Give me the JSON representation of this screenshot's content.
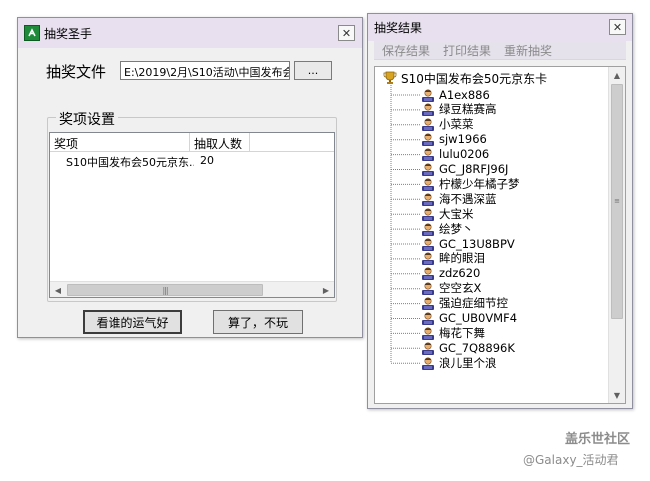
{
  "main_window": {
    "title": "抽奖圣手",
    "close_glyph": "✕",
    "file_label": "抽奖文件",
    "file_path": "E:\\2019\\2月\\S10活动\\中国发布会",
    "browse_label": "...",
    "group_label": "奖项设置",
    "columns": [
      "奖项",
      "抽取人数"
    ],
    "rows": [
      {
        "prize": "S10中国发布会50元京东...",
        "count": "20"
      }
    ],
    "scroll_left": "◀",
    "scroll_right": "▶",
    "scroll_grip": "|||",
    "lucky_button": "看谁的运气好",
    "quit_button": "算了，不玩"
  },
  "results_window": {
    "title": "抽奖结果",
    "close_glyph": "✕",
    "menu": [
      "保存结果",
      "打印结果",
      "重新抽奖"
    ],
    "root": "S10中国发布会50元京东卡",
    "winners": [
      "A1ex886",
      "绿豆糕赛高",
      "小菜菜",
      "sjw1966",
      "lulu0206",
      "GC_J8RFJ96J",
      "柠檬少年橘子梦",
      "海不遇深蓝",
      "大宝米",
      "绘梦丶",
      "GC_13U8BPV",
      "眸的眼泪",
      "zdz620",
      "空空玄X",
      "强迫症细节控",
      "GC_UB0VMF4",
      "梅花下舞",
      "GC_7Q8896K",
      "浪儿里个浪"
    ],
    "scroll_up": "▲",
    "scroll_down": "▼",
    "scroll_grip": "≡"
  },
  "watermark": {
    "line1": "盖乐世社区",
    "line2": "@Galaxy_活动君"
  },
  "colors": {
    "titlebar": "#e8e0ef",
    "window_bg": "#f0f0f0",
    "menu_disabled": "#8a8a8a"
  }
}
